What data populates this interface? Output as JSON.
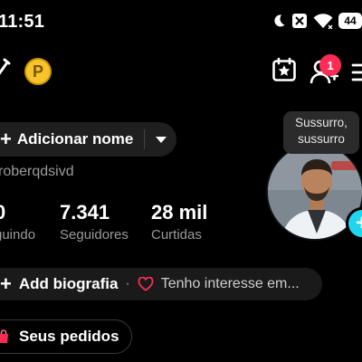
{
  "status_bar": {
    "time": "11:51",
    "battery": "44",
    "icons": [
      "moon-icon",
      "notification-off-icon",
      "wifi-icon",
      "battery-icon"
    ]
  },
  "header": {
    "coin_label": "P",
    "notification_count": "1",
    "icons": [
      "pencil-icon",
      "coin-icon",
      "calendar-star-icon",
      "add-friend-icon",
      "menu-icon"
    ]
  },
  "profile": {
    "add_name_label": "Adicionar nome",
    "username": "roberqdsivd",
    "tooltip": "Sussurro, sussurro"
  },
  "stats": [
    {
      "value": "0",
      "label": "guindo"
    },
    {
      "value": "7.341",
      "label": "Seguidores"
    },
    {
      "value": "28 mil",
      "label": "Curtidas"
    }
  ],
  "bio": {
    "add_bio_label": "Add biografia",
    "separator": "·",
    "interest_label": "Tenho interesse em..."
  },
  "orders": {
    "label": "Seus pedidos"
  },
  "colors": {
    "background": "#000000",
    "accent_red": "#fe2c55",
    "accent_cyan": "#20d5ec",
    "coin": "#f7c52b",
    "muted_text": "#9b9b9b"
  }
}
